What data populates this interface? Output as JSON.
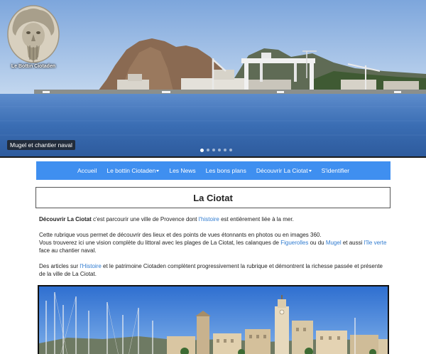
{
  "hero": {
    "logo_caption": "Le Bottin Ciotaden",
    "slide_caption": "Mugel et chantier naval",
    "slides_total": 6,
    "slide_active": 1
  },
  "nav": {
    "items": [
      {
        "label": "Accueil",
        "dropdown": false
      },
      {
        "label": "Le bottin Ciotaden",
        "dropdown": true
      },
      {
        "label": "Les News",
        "dropdown": false
      },
      {
        "label": "Les bons plans",
        "dropdown": false
      },
      {
        "label": "Découvrir La Ciotat",
        "dropdown": true
      },
      {
        "label": "S'identifier",
        "dropdown": false
      }
    ]
  },
  "page": {
    "title": "La Ciotat"
  },
  "content": {
    "p1": {
      "bold": "Découvrir La Ciotat",
      "t1": " c'est parcourir une ville de Provence dont ",
      "link1": "l'histoire",
      "t2": " est entièrement liée à la mer."
    },
    "p2": {
      "line1": "Cette rubrique vous permet de découvrir des lieux et des points de vues étonnants en photos ou en images 360.",
      "t1": "Vous trouverez ici une vision complète du littoral avec les plages de La Ciotat, les calanques de ",
      "link1": "Figuerolles",
      "t2": " ou du ",
      "link2": "Mugel",
      "t3": " et aussi ",
      "link3": "l'île verte",
      "t4": " face au chantier naval."
    },
    "p3": {
      "t1": "Des articles sur ",
      "link1": "l'Histoire",
      "t2": " et le patrimoine Ciotaden complètent progressivement la rubrique et démontrent la richesse passée et présente de la ville de La Ciotat."
    }
  },
  "colors": {
    "nav_bg": "#3f8ff0",
    "link": "#2f7bd0",
    "sky": "#8fb3e0",
    "sea": "#3f72b8"
  }
}
